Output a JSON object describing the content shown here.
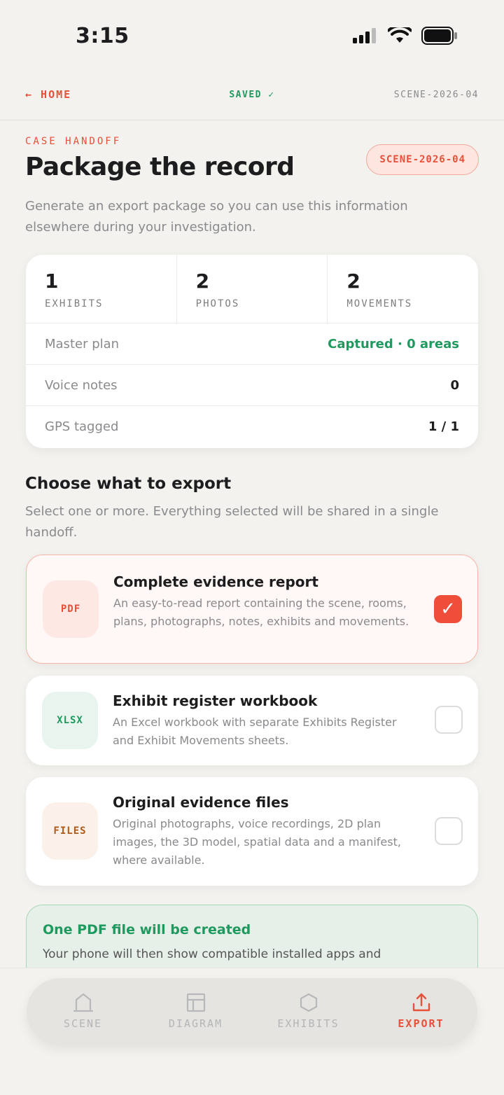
{
  "status": {
    "time": "3:15"
  },
  "nav": {
    "home": "← HOME",
    "saved": "SAVED ✓",
    "scene": "SCENE-2026-04"
  },
  "header": {
    "eyebrow": "CASE HANDOFF",
    "title": "Package the record",
    "badge": "SCENE-2026-04",
    "subtitle": "Generate an export package so you can use this information elsewhere during your investigation."
  },
  "stats": {
    "items": [
      {
        "value": "1",
        "label": "EXHIBITS"
      },
      {
        "value": "2",
        "label": "PHOTOS"
      },
      {
        "value": "2",
        "label": "MOVEMENTS"
      }
    ],
    "rows": [
      {
        "label": "Master plan",
        "value": "Captured · 0 areas"
      },
      {
        "label": "Voice notes",
        "value": "0"
      },
      {
        "label": "GPS tagged",
        "value": "1 / 1"
      }
    ]
  },
  "export": {
    "title": "Choose what to export",
    "subtitle": "Select one or more. Everything selected will be shared in a single handoff.",
    "options": [
      {
        "badge": "PDF",
        "title": "Complete evidence report",
        "desc": "An easy-to-read report containing the scene, rooms, plans, photographs, notes, exhibits and movements.",
        "selected": true,
        "check": "✓"
      },
      {
        "badge": "XLSX",
        "title": "Exhibit register workbook",
        "desc": "An Excel workbook with separate Exhibits Register and Exhibit Movements sheets.",
        "selected": false
      },
      {
        "badge": "FILES",
        "title": "Original evidence files",
        "desc": "Original photographs, voice recordings, 2D plan images, the 3D model, spatial data and a manifest, where available.",
        "selected": false
      }
    ]
  },
  "info": {
    "title": "One PDF file will be created",
    "text": "Your phone will then show compatible installed apps and"
  },
  "tabs": [
    {
      "label": "SCENE",
      "icon": "house-icon"
    },
    {
      "label": "DIAGRAM",
      "icon": "layout-icon"
    },
    {
      "label": "EXHIBITS",
      "icon": "hexagon-icon"
    },
    {
      "label": "EXPORT",
      "icon": "share-icon",
      "active": true
    }
  ],
  "colors": {
    "accent": "#e8503a",
    "success": "#1f9a5e",
    "background": "#f3f2ee"
  }
}
